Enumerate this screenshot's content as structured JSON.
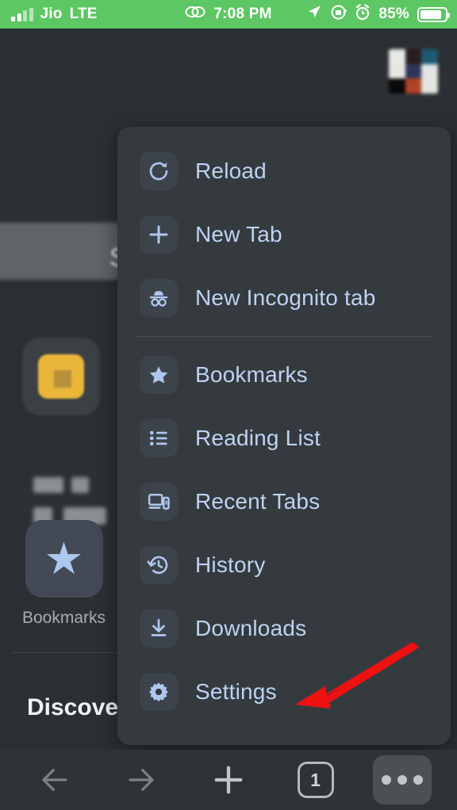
{
  "status_bar": {
    "carrier": "Jio",
    "network": "LTE",
    "time": "7:08 PM",
    "battery_percent": "85%",
    "icons": [
      "signal-bars-icon",
      "link-icon",
      "location-arrow-icon",
      "rotation-lock-icon",
      "alarm-clock-icon",
      "battery-icon"
    ],
    "background_color": "#5dc763",
    "text_color": "#ffffff"
  },
  "new_tab_page": {
    "omnibox_text": "S",
    "tiles": [
      {
        "name": "folder-tile",
        "label": ""
      },
      {
        "name": "bookmarks-tile",
        "label": "Bookmarks",
        "icon": "star-icon"
      }
    ],
    "feed_heading": "Discover",
    "avatar_colors": [
      "#e8e9e6",
      "#2a1e22",
      "#1f5a72",
      "#e7e8e5",
      "#2e3558",
      "#e3e5e0",
      "#090909",
      "#b24426",
      "#e3e5e0"
    ]
  },
  "menu": {
    "background_color": "#353a3f",
    "label_color": "#bdd3f2",
    "groups": [
      {
        "items": [
          {
            "label": "Reload",
            "icon": "reload-icon",
            "name": "menu-item-reload"
          },
          {
            "label": "New Tab",
            "icon": "plus-icon",
            "name": "menu-item-new-tab"
          },
          {
            "label": "New Incognito tab",
            "icon": "incognito-icon",
            "name": "menu-item-new-incognito-tab"
          }
        ]
      },
      {
        "items": [
          {
            "label": "Bookmarks",
            "icon": "star-icon",
            "name": "menu-item-bookmarks"
          },
          {
            "label": "Reading List",
            "icon": "list-icon",
            "name": "menu-item-reading-list"
          },
          {
            "label": "Recent Tabs",
            "icon": "devices-icon",
            "name": "menu-item-recent-tabs"
          },
          {
            "label": "History",
            "icon": "history-clock-icon",
            "name": "menu-item-history"
          },
          {
            "label": "Downloads",
            "icon": "download-icon",
            "name": "menu-item-downloads"
          },
          {
            "label": "Settings",
            "icon": "gear-icon",
            "name": "menu-item-settings"
          }
        ]
      }
    ]
  },
  "annotation": {
    "type": "arrow",
    "color": "#ee1111",
    "points_to": "Settings"
  },
  "bottom_toolbar": {
    "background_color": "#2e3337",
    "buttons": [
      {
        "name": "back-button",
        "icon": "arrow-left-icon",
        "label": ""
      },
      {
        "name": "forward-button",
        "icon": "arrow-right-icon",
        "label": ""
      },
      {
        "name": "new-tab-button",
        "icon": "plus-icon",
        "label": ""
      },
      {
        "name": "tab-switcher-button",
        "icon": "tab-count-icon",
        "label": "1"
      },
      {
        "name": "menu-button",
        "icon": "overflow-dots-icon",
        "label": ""
      }
    ],
    "tab_count": "1"
  }
}
